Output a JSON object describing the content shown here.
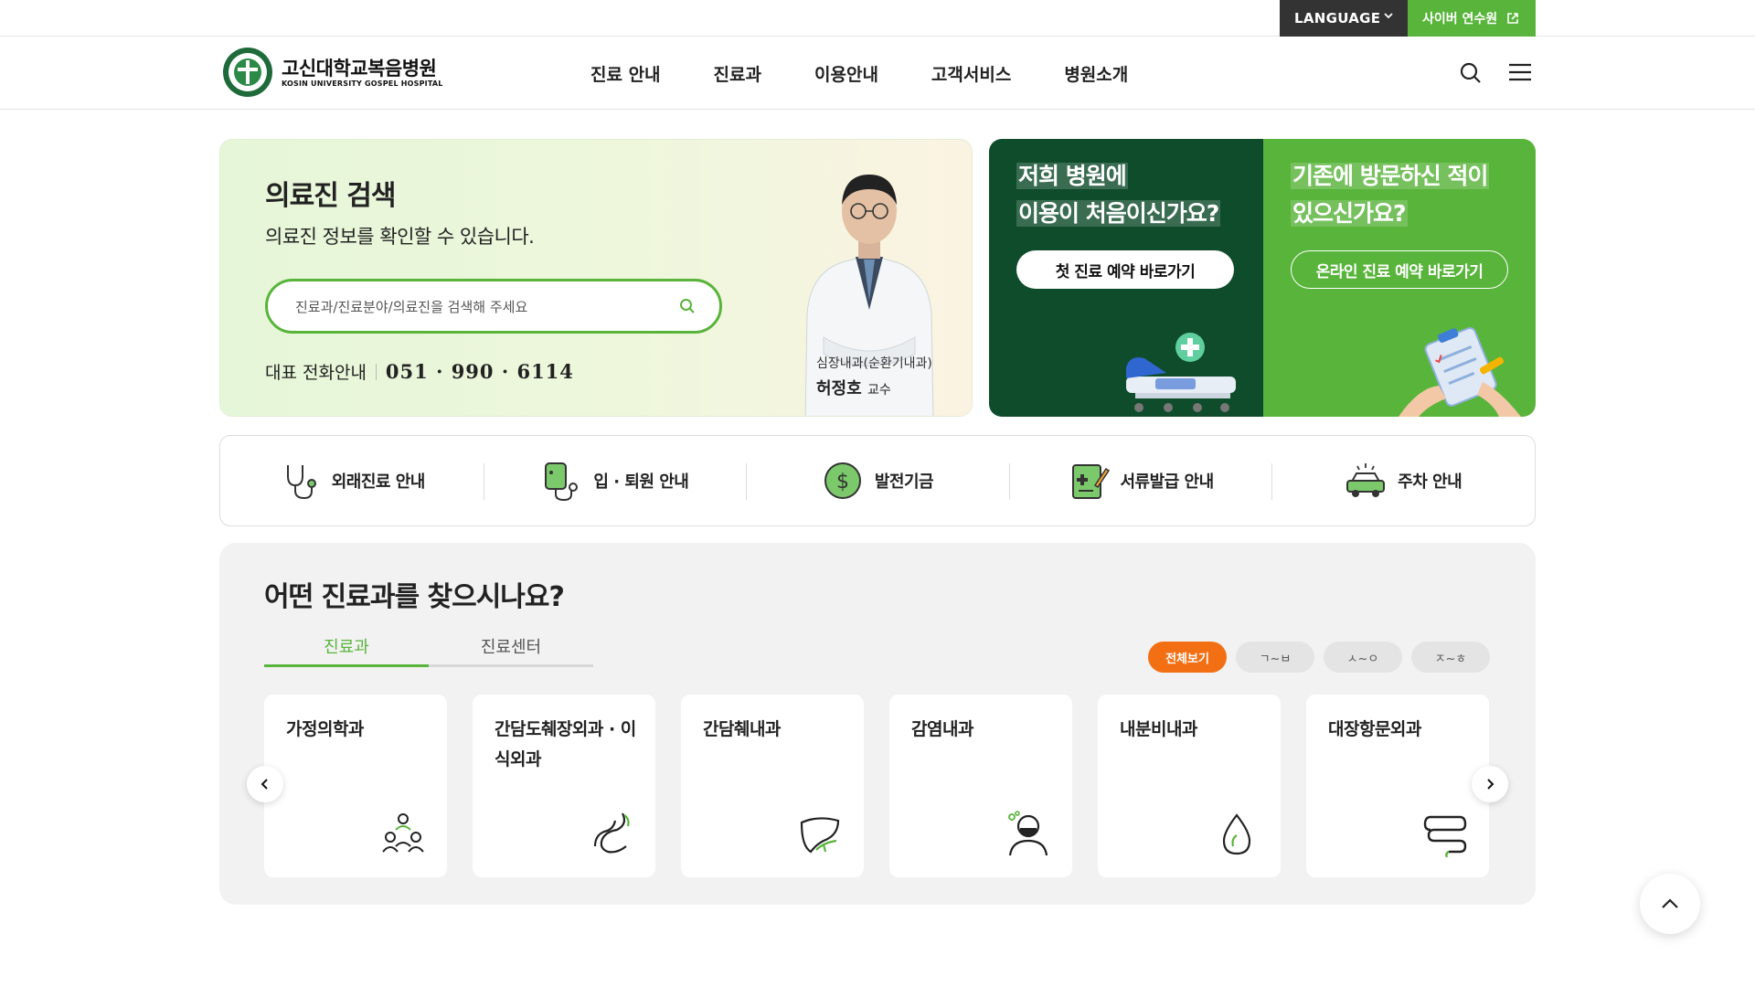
{
  "topbar": {
    "language_label": "LANGUAGE",
    "cyber_label": "사이버 연수원"
  },
  "header": {
    "logo_ko": "고신대학교복음병원",
    "logo_en": "KOSIN UNIVERSITY GOSPEL HOSPITAL",
    "nav": [
      "진료 안내",
      "진료과",
      "이용안내",
      "고객서비스",
      "병원소개"
    ]
  },
  "doctor_search": {
    "title": "의료진 검색",
    "subtitle": "의료진 정보를 확인할 수 있습니다.",
    "placeholder": "진료과/진료분야/의료진을 검색해 주세요",
    "phone_label": "대표 전화안내",
    "phone_number": "051 · 990 · 6114",
    "doctor_dept": "심장내과(순환기내과)",
    "doctor_name": "허정호",
    "doctor_role": "교수"
  },
  "banners": {
    "first": {
      "line1": "저희 병원에",
      "line2": "이용이 처음이신가요?",
      "button": "첫 진료 예약 바로가기"
    },
    "visit": {
      "line1": "기존에 방문하신 적이",
      "line2": "있으신가요?",
      "button": "온라인 진료 예약 바로가기"
    }
  },
  "quick_menu": [
    {
      "label": "외래진료 안내",
      "icon": "stethoscope-icon"
    },
    {
      "label": "입 · 퇴원 안내",
      "icon": "iv-bag-icon"
    },
    {
      "label": "발전기금",
      "icon": "dollar-coin-icon"
    },
    {
      "label": "서류발급 안내",
      "icon": "document-pen-icon"
    },
    {
      "label": "주차 안내",
      "icon": "car-icon"
    }
  ],
  "departments": {
    "title": "어떤 진료과를 찾으시나요?",
    "tabs": [
      "진료과",
      "진료센터"
    ],
    "filters": [
      "전체보기",
      "ㄱ~ㅂ",
      "ㅅ~ㅇ",
      "ㅈ~ㅎ"
    ],
    "cards": [
      {
        "name": "가정의학과",
        "icon": "family-icon"
      },
      {
        "name": "간담도췌장외과 · 이식외과",
        "icon": "pancreas-icon"
      },
      {
        "name": "간담췌내과",
        "icon": "liver-icon"
      },
      {
        "name": "감염내과",
        "icon": "mask-person-icon"
      },
      {
        "name": "내분비내과",
        "icon": "drop-icon"
      },
      {
        "name": "대장항문외과",
        "icon": "intestine-icon"
      }
    ]
  },
  "colors": {
    "brand_green": "#58b43a",
    "dark_green": "#0e4c2b",
    "accent_orange": "#f36f13"
  }
}
